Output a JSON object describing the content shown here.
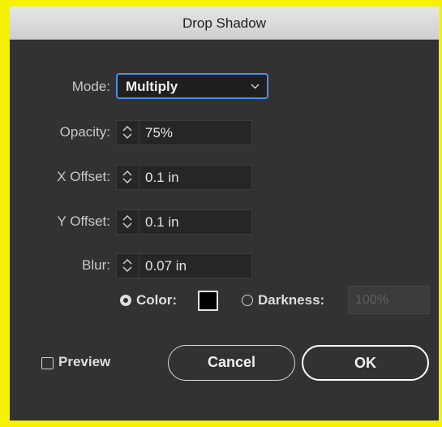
{
  "dialog": {
    "title": "Drop Shadow"
  },
  "mode": {
    "label": "Mode:",
    "value": "Multiply"
  },
  "opacity": {
    "label": "Opacity:",
    "value": "75%"
  },
  "x_offset": {
    "label": "X Offset:",
    "value": "0.1 in"
  },
  "y_offset": {
    "label": "Y Offset:",
    "value": "0.1 in"
  },
  "blur": {
    "label": "Blur:",
    "value": "0.07 in"
  },
  "shadow_source": {
    "selected": "color",
    "color_label": "Color:",
    "swatch_color": "#000000",
    "darkness_label": "Darkness:",
    "darkness_value": "100%"
  },
  "preview": {
    "label": "Preview",
    "checked": false
  },
  "buttons": {
    "cancel": "Cancel",
    "ok": "OK"
  },
  "colors": {
    "accent": "#4c90ea",
    "background": "#323232",
    "frame": "#f7f200"
  },
  "icons": {
    "stepper": "stepper-arrows-icon",
    "dropdown": "chevron-down-icon"
  }
}
